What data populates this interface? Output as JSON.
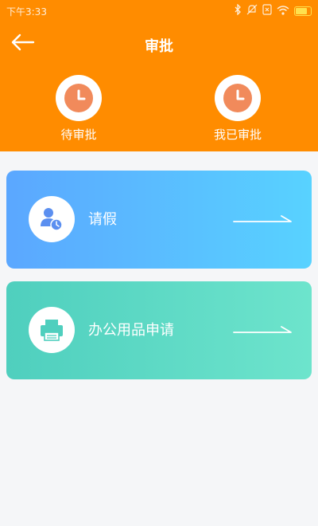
{
  "status_bar": {
    "time": "下午3:33",
    "icons": [
      "bluetooth-icon",
      "mute-icon",
      "no-sim-icon",
      "wifi-icon",
      "battery-icon"
    ]
  },
  "header": {
    "title": "审批",
    "back_icon": "back-arrow-icon",
    "background_color": "#ff8c00"
  },
  "quick_actions": [
    {
      "label": "待审批",
      "icon": "clock-icon"
    },
    {
      "label": "我已审批",
      "icon": "clock-icon"
    }
  ],
  "cards": [
    {
      "label": "请假",
      "icon": "user-clock-icon",
      "arrow_icon": "arrow-right-icon",
      "gradient": [
        "#5ba7ff",
        "#58d2ff"
      ]
    },
    {
      "label": "办公用品申请",
      "icon": "printer-icon",
      "arrow_icon": "arrow-right-icon",
      "gradient": [
        "#4fcfbe",
        "#6de4cc"
      ]
    }
  ]
}
